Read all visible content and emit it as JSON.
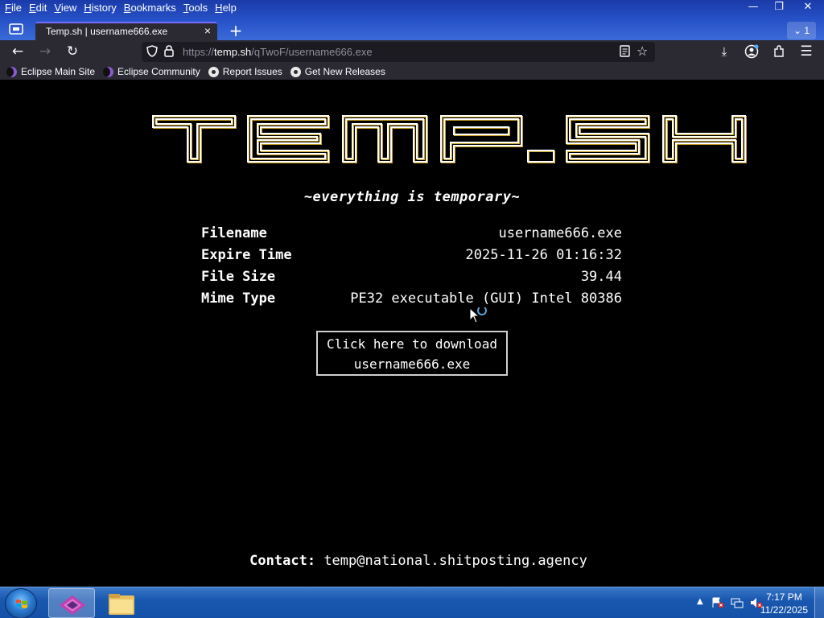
{
  "menu": [
    {
      "label": "File",
      "accel": "F",
      "rest": "ile"
    },
    {
      "label": "Edit",
      "accel": "E",
      "rest": "dit"
    },
    {
      "label": "View",
      "accel": "V",
      "rest": "iew"
    },
    {
      "label": "History",
      "accel": "H",
      "rest": "istory"
    },
    {
      "label": "Bookmarks",
      "accel": "B",
      "rest": "ookmarks"
    },
    {
      "label": "Tools",
      "accel": "T",
      "rest": "ools"
    },
    {
      "label": "Help",
      "accel": "H",
      "rest": "elp"
    }
  ],
  "tab": {
    "title": "Temp.sh | username666.exe",
    "close": "×",
    "count": "1"
  },
  "urlbar": {
    "prefix": "https://",
    "host": "temp.sh",
    "path": "/qTwoF/username666.exe"
  },
  "bookmarks": [
    {
      "label": "Eclipse Main Site",
      "icon": "eclipse-icon"
    },
    {
      "label": "Eclipse Community",
      "icon": "eclipse-icon"
    },
    {
      "label": "Report Issues",
      "icon": "github-icon"
    },
    {
      "label": "Get New Releases",
      "icon": "github-icon"
    }
  ],
  "page": {
    "logo": "TEMP.SH",
    "tagline": "~everything is temporary~",
    "details": [
      {
        "key": "Filename",
        "value": "username666.exe"
      },
      {
        "key": "Expire Time",
        "value": "2025-11-26 01:16:32"
      },
      {
        "key": "File Size",
        "value": "39.44"
      },
      {
        "key": "Mime Type",
        "value": "PE32 executable (GUI) Intel 80386"
      }
    ],
    "download": {
      "line1": "Click here to download",
      "line2": "username666.exe"
    },
    "contact": {
      "label": "Contact:",
      "email": "temp@national.shitposting.agency"
    }
  },
  "taskbar": {
    "time": "7:17 PM",
    "date": "11/22/2025"
  },
  "colors": {
    "toolbar": "#2b2a33",
    "tab_accent": "#7a6cff",
    "page_bg": "#000000",
    "taskbar": "#1a58b0"
  }
}
